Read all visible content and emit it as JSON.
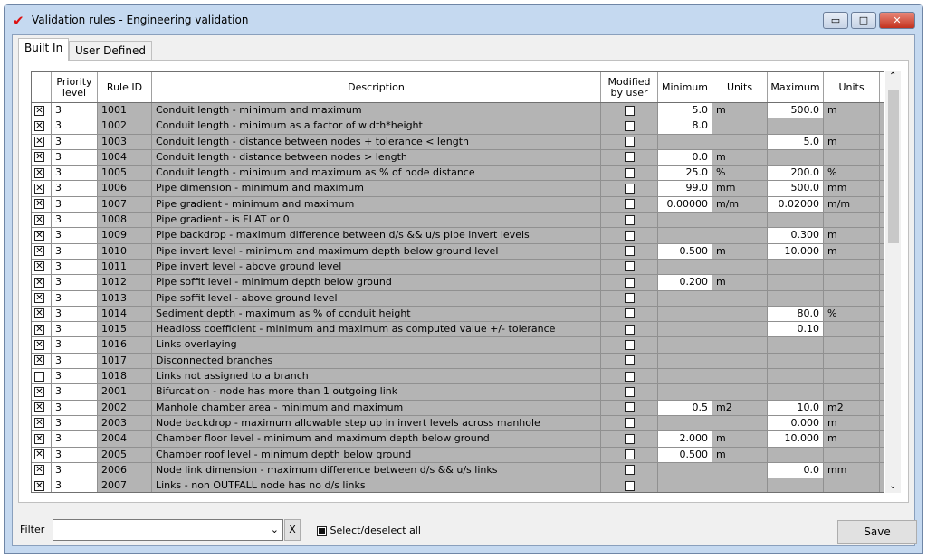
{
  "window": {
    "title": "Validation rules - Engineering validation",
    "minimize": "▭",
    "maximize": "□",
    "close": "✕"
  },
  "tabs": [
    {
      "label": "Built In"
    },
    {
      "label": "User Defined"
    }
  ],
  "columns": [
    "",
    "Priority level",
    "Rule ID",
    "Description",
    "Modified by user",
    "Minimum",
    "Units",
    "Maximum",
    "Units"
  ],
  "rows": [
    {
      "on": true,
      "p": "3",
      "id": "1001",
      "d": "Conduit length - minimum and maximum",
      "min": "5.0",
      "mu": "m",
      "max": "500.0",
      "xu": "m"
    },
    {
      "on": true,
      "p": "3",
      "id": "1002",
      "d": "Conduit length - minimum as a factor of width*height",
      "min": "8.0",
      "mu": "",
      "max": "",
      "xu": ""
    },
    {
      "on": true,
      "p": "3",
      "id": "1003",
      "d": "Conduit length - distance between nodes + tolerance < length",
      "min": "",
      "mu": "",
      "max": "5.0",
      "xu": "m"
    },
    {
      "on": true,
      "p": "3",
      "id": "1004",
      "d": "Conduit length - distance between nodes > length",
      "min": "0.0",
      "mu": "m",
      "max": "",
      "xu": ""
    },
    {
      "on": true,
      "p": "3",
      "id": "1005",
      "d": "Conduit length - minimum and maximum as % of node distance",
      "min": "25.0",
      "mu": "%",
      "max": "200.0",
      "xu": "%"
    },
    {
      "on": true,
      "p": "3",
      "id": "1006",
      "d": "Pipe dimension - minimum and maximum",
      "min": "99.0",
      "mu": "mm",
      "max": "500.0",
      "xu": "mm"
    },
    {
      "on": true,
      "p": "3",
      "id": "1007",
      "d": "Pipe gradient - minimum and maximum",
      "min": "0.00000",
      "mu": "m/m",
      "max": "0.02000",
      "xu": "m/m"
    },
    {
      "on": true,
      "p": "3",
      "id": "1008",
      "d": "Pipe gradient - is FLAT or 0",
      "min": "",
      "mu": "",
      "max": "",
      "xu": ""
    },
    {
      "on": true,
      "p": "3",
      "id": "1009",
      "d": "Pipe backdrop - maximum difference between d/s && u/s pipe invert levels",
      "min": "",
      "mu": "",
      "max": "0.300",
      "xu": "m"
    },
    {
      "on": true,
      "p": "3",
      "id": "1010",
      "d": "Pipe invert level - minimum and maximum depth below ground level",
      "min": "0.500",
      "mu": "m",
      "max": "10.000",
      "xu": "m"
    },
    {
      "on": true,
      "p": "3",
      "id": "1011",
      "d": "Pipe invert level - above ground level",
      "min": "",
      "mu": "",
      "max": "",
      "xu": ""
    },
    {
      "on": true,
      "p": "3",
      "id": "1012",
      "d": "Pipe soffit level - minimum depth below ground",
      "min": "0.200",
      "mu": "m",
      "max": "",
      "xu": ""
    },
    {
      "on": true,
      "p": "3",
      "id": "1013",
      "d": "Pipe soffit level - above ground level",
      "min": "",
      "mu": "",
      "max": "",
      "xu": ""
    },
    {
      "on": true,
      "p": "3",
      "id": "1014",
      "d": "Sediment depth - maximum as % of conduit height",
      "min": "",
      "mu": "",
      "max": "80.0",
      "xu": "%"
    },
    {
      "on": true,
      "p": "3",
      "id": "1015",
      "d": "Headloss coefficient - minimum and maximum as computed value +/- tolerance",
      "min": "",
      "mu": "",
      "max": "0.10",
      "xu": ""
    },
    {
      "on": true,
      "p": "3",
      "id": "1016",
      "d": "Links overlaying",
      "min": "",
      "mu": "",
      "max": "",
      "xu": ""
    },
    {
      "on": true,
      "p": "3",
      "id": "1017",
      "d": "Disconnected branches",
      "min": "",
      "mu": "",
      "max": "",
      "xu": ""
    },
    {
      "on": false,
      "p": "3",
      "id": "1018",
      "d": "Links not assigned to a branch",
      "min": "",
      "mu": "",
      "max": "",
      "xu": ""
    },
    {
      "on": true,
      "p": "3",
      "id": "2001",
      "d": "Bifurcation - node has more than 1 outgoing link",
      "min": "",
      "mu": "",
      "max": "",
      "xu": ""
    },
    {
      "on": true,
      "p": "3",
      "id": "2002",
      "d": "Manhole chamber area - minimum and maximum",
      "min": "0.5",
      "mu": "m2",
      "max": "10.0",
      "xu": "m2"
    },
    {
      "on": true,
      "p": "3",
      "id": "2003",
      "d": "Node backdrop - maximum allowable step up in invert levels across manhole",
      "min": "",
      "mu": "",
      "max": "0.000",
      "xu": "m"
    },
    {
      "on": true,
      "p": "3",
      "id": "2004",
      "d": "Chamber floor level - minimum and maximum depth below ground",
      "min": "2.000",
      "mu": "m",
      "max": "10.000",
      "xu": "m"
    },
    {
      "on": true,
      "p": "3",
      "id": "2005",
      "d": "Chamber roof level - minimum depth below ground",
      "min": "0.500",
      "mu": "m",
      "max": "",
      "xu": ""
    },
    {
      "on": true,
      "p": "3",
      "id": "2006",
      "d": "Node link dimension - maximum difference between d/s && u/s links",
      "min": "",
      "mu": "",
      "max": "0.0",
      "xu": "mm"
    },
    {
      "on": true,
      "p": "3",
      "id": "2007",
      "d": "Links - non OUTFALL node has no d/s links",
      "min": "",
      "mu": "",
      "max": "",
      "xu": ""
    }
  ],
  "footer": {
    "filter_label": "Filter",
    "filter_value": "",
    "clear_label": "X",
    "select_all_label": "Select/deselect all",
    "save_label": "Save"
  }
}
